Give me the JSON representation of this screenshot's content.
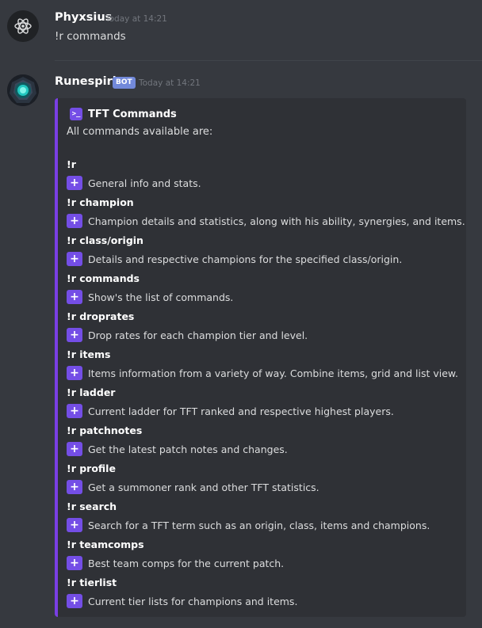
{
  "messages": [
    {
      "username": "Phyxsius",
      "timestamp": "Today at 14:21",
      "content": "!r commands",
      "avatar_icon": "atom-icon"
    },
    {
      "username": "Runespirit",
      "bot_tag": "BOT",
      "timestamp": "Today at 14:21",
      "avatar_icon": "glowing-orb-icon"
    }
  ],
  "embed": {
    "accent_color": "#7a3fe4",
    "icon": "terminal-icon",
    "title": "TFT Commands",
    "description": "All commands available are:",
    "commands": [
      {
        "name": "!r",
        "description": "General info and stats."
      },
      {
        "name": "!r champion",
        "description": "Champion details and statistics, along with his ability, synergies, and items."
      },
      {
        "name": "!r class/origin",
        "description": "Details and respective champions for the specified class/origin."
      },
      {
        "name": "!r commands",
        "description": "Show's the list of commands."
      },
      {
        "name": "!r droprates",
        "description": "Drop rates for each champion tier and level."
      },
      {
        "name": "!r items",
        "description": "Items information from a variety of way. Combine items, grid and list view."
      },
      {
        "name": "!r ladder",
        "description": "Current ladder for TFT ranked and respective highest players."
      },
      {
        "name": "!r patchnotes",
        "description": "Get the latest patch notes and changes."
      },
      {
        "name": "!r profile",
        "description": "Get a summoner rank and other TFT statistics."
      },
      {
        "name": "!r search",
        "description": "Search for a TFT term such as an origin, class, items and champions."
      },
      {
        "name": "!r teamcomps",
        "description": "Best team comps for the current patch."
      },
      {
        "name": "!r tierlist",
        "description": "Current tier lists for champions and items."
      }
    ],
    "bullet_icon": "plus-icon"
  },
  "colors": {
    "background": "#36393f",
    "embed_background": "#2f3136",
    "accent": "#744ee6",
    "bot_tag": "#7289da"
  }
}
